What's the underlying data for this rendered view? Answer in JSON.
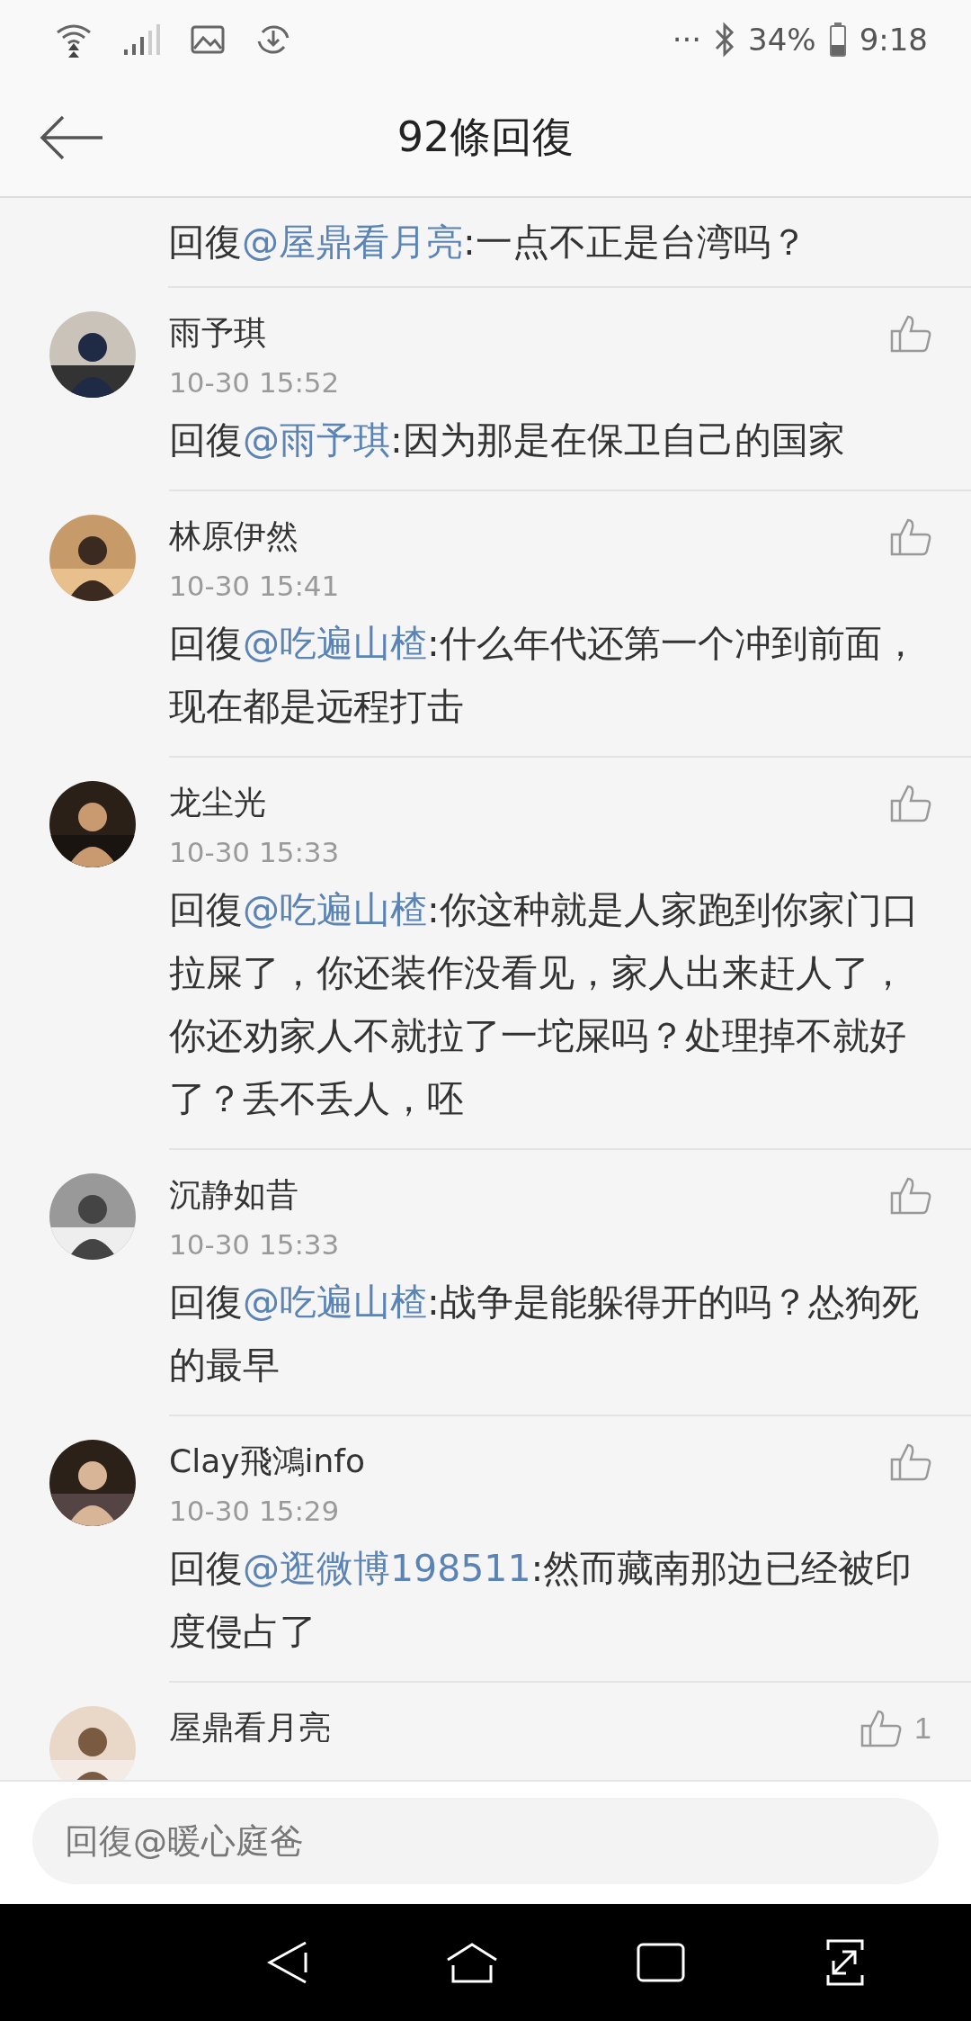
{
  "status_bar": {
    "battery": "34%",
    "time": "9:18",
    "more": "···"
  },
  "header": {
    "title": "92條回復"
  },
  "comments": [
    {
      "prefix": "回復",
      "mention": "@屋鼎看月亮",
      "body": ":一点不正是台湾吗？"
    },
    {
      "name": "雨予琪",
      "time": "10-30 15:52",
      "prefix": "回復",
      "mention": "@雨予琪",
      "body": ":因为那是在保卫自己的国家"
    },
    {
      "name": "林原伊然",
      "time": "10-30 15:41",
      "prefix": "回復",
      "mention": "@吃遍山楂",
      "body": ":什么年代还第一个冲到前面，现在都是远程打击"
    },
    {
      "name": "龙尘光",
      "time": "10-30 15:33",
      "prefix": "回復",
      "mention": "@吃遍山楂",
      "body": ":你这种就是人家跑到你家门口拉屎了，你还装作没看见，家人出来赶人了，你还劝家人不就拉了一坨屎吗？处理掉不就好了？丢不丢人，呸"
    },
    {
      "name": "沉静如昔",
      "time": "10-30 15:33",
      "prefix": "回復",
      "mention": "@吃遍山楂",
      "body": ":战争是能躲得开的吗？怂狗死的最早"
    },
    {
      "name": "Clay飛鴻info",
      "time": "10-30 15:29",
      "prefix": "回復",
      "mention": "@逛微博198511",
      "body": ":然而藏南那边已经被印度侵占了"
    },
    {
      "name": "屋鼎看月亮",
      "likes": "1"
    }
  ],
  "reply_field": {
    "placeholder": "回復@暖心庭爸"
  }
}
